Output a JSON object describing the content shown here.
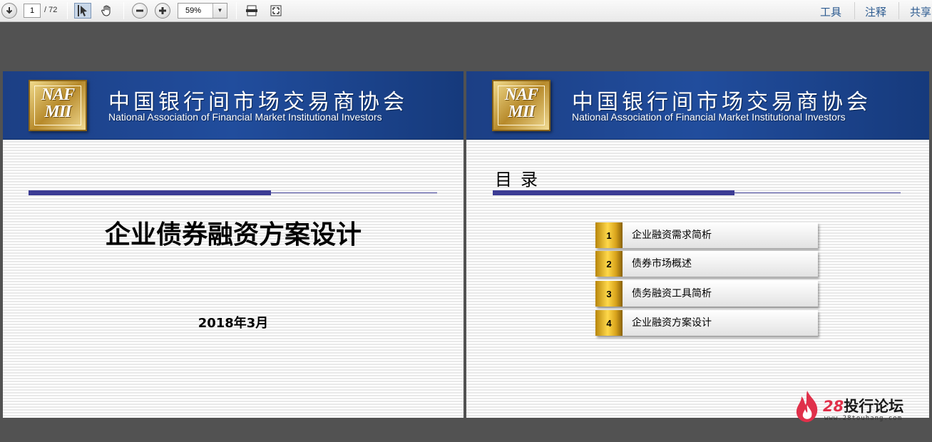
{
  "toolbar": {
    "current_page": "1",
    "total_pages": "/ 72",
    "zoom": "59%",
    "links": [
      "工具",
      "注释",
      "共享"
    ]
  },
  "slides": {
    "banner": {
      "logo_line1": "NAF",
      "logo_line2": "MII",
      "org_cn": "中国银行间市场交易商协会",
      "org_en": "National Association of Financial Market Institutional Investors"
    },
    "cover": {
      "title": "企业债券融资方案设计",
      "date": "2018年3月"
    },
    "toc": {
      "heading": "目录",
      "items": [
        {
          "num": "1",
          "label": "企业融资需求简析"
        },
        {
          "num": "2",
          "label": "债券市场概述"
        },
        {
          "num": "3",
          "label": "债务融资工具简析"
        },
        {
          "num": "4",
          "label": "企业融资方案设计"
        }
      ]
    }
  },
  "watermark": {
    "number": "28",
    "name": "投行论坛",
    "url": "www.28touhang.com"
  },
  "colors": {
    "banner_blue": "#214d9d",
    "rule": "#3c3c94",
    "gold": "#ffd84a",
    "link": "#2d5b90"
  }
}
